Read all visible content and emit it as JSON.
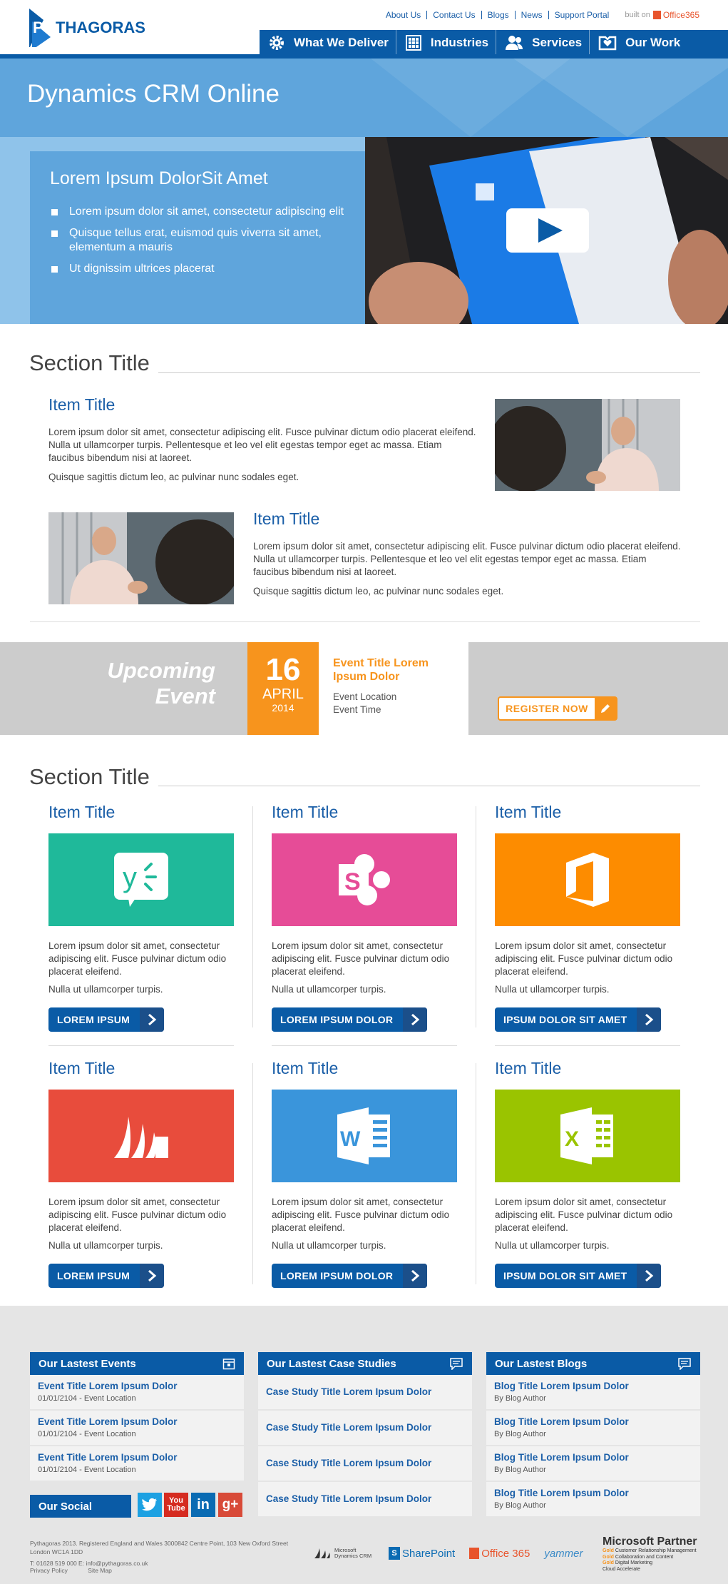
{
  "brand": {
    "logo_text": "PYTHAGORAS",
    "accent": "#0a5ba6"
  },
  "toplinks": [
    "About Us",
    "Contact Us",
    "Blogs",
    "News",
    "Support Portal"
  ],
  "built_on": {
    "label": "built on",
    "product": "Office365"
  },
  "nav": [
    {
      "label": "What We Deliver",
      "icon": "gear-icon"
    },
    {
      "label": "Industries",
      "icon": "grid-icon"
    },
    {
      "label": "Services",
      "icon": "people-icon"
    },
    {
      "label": "Our Work",
      "icon": "heart-box-icon"
    }
  ],
  "hero": {
    "title": "Dynamics CRM Online"
  },
  "feature": {
    "heading": "Lorem Ipsum DolorSit Amet",
    "bullets": [
      "Lorem ipsum dolor sit amet, consectetur adipiscing elit",
      "Quisque tellus erat, euismod quis viverra sit amet, elementum a mauris",
      "Ut dignissim ultrices placerat"
    ]
  },
  "section1": {
    "title": "Section Title",
    "items": [
      {
        "title": "Item Title",
        "text": "Lorem ipsum dolor sit amet, consectetur adipiscing elit. Fusce pulvinar dictum odio placerat eleifend. Nulla ut ullamcorper turpis. Pellentesque et leo vel elit egestas tempor eget ac massa. Etiam faucibus bibendum nisi at laoreet.",
        "text2": "Quisque sagittis dictum leo, ac pulvinar nunc sodales eget."
      },
      {
        "title": "Item Title",
        "text": "Lorem ipsum dolor sit amet, consectetur adipiscing elit. Fusce pulvinar dictum odio placerat eleifend. Nulla ut ullamcorper turpis. Pellentesque et leo vel elit egestas tempor eget ac massa. Etiam faucibus bibendum nisi at laoreet.",
        "text2": "Quisque sagittis dictum leo, ac pulvinar nunc sodales eget."
      }
    ]
  },
  "event": {
    "heading_line1": "Upcoming",
    "heading_line2": "Event",
    "day": "16",
    "month": "APRIL",
    "year": "2014",
    "title": "Event Title Lorem Ipsum Dolor",
    "location": "Event Location",
    "time": "Event Time",
    "register": "REGISTER NOW"
  },
  "section2": {
    "title": "Section Title",
    "cards": [
      {
        "title": "Item Title",
        "color": "#1fb99a",
        "icon": "yammer-icon",
        "text": "Lorem ipsum dolor sit amet, consectetur adipiscing elit. Fusce pulvinar dictum odio placerat eleifend.",
        "text2": "Nulla ut ullamcorper turpis.",
        "button": "LOREM IPSUM"
      },
      {
        "title": "Item Title",
        "color": "#e64c97",
        "icon": "sharepoint-icon",
        "text": "Lorem ipsum dolor sit amet, consectetur adipiscing elit. Fusce pulvinar dictum odio placerat eleifend.",
        "text2": "Nulla ut ullamcorper turpis.",
        "button": "LOREM IPSUM DOLOR"
      },
      {
        "title": "Item Title",
        "color": "#fd8c00",
        "icon": "office-icon",
        "text": "Lorem ipsum dolor sit amet, consectetur adipiscing elit. Fusce pulvinar dictum odio placerat eleifend.",
        "text2": "Nulla ut ullamcorper turpis.",
        "button": "IPSUM DOLOR SIT AMET"
      },
      {
        "title": "Item Title",
        "color": "#e84c3c",
        "icon": "dynamics-icon",
        "text": "Lorem ipsum dolor sit amet, consectetur adipiscing elit. Fusce pulvinar dictum odio placerat eleifend.",
        "text2": "Nulla ut ullamcorper turpis.",
        "button": "LOREM IPSUM"
      },
      {
        "title": "Item Title",
        "color": "#3a95db",
        "icon": "word-icon",
        "text": "Lorem ipsum dolor sit amet, consectetur adipiscing elit. Fusce pulvinar dictum odio placerat eleifend.",
        "text2": "Nulla ut ullamcorper turpis.",
        "button": "LOREM IPSUM DOLOR"
      },
      {
        "title": "Item Title",
        "color": "#9ac400",
        "icon": "excel-icon",
        "text": "Lorem ipsum dolor sit amet, consectetur adipiscing elit. Fusce pulvinar dictum odio placerat eleifend.",
        "text2": "Nulla ut ullamcorper turpis.",
        "button": "IPSUM DOLOR SIT AMET"
      }
    ]
  },
  "footer": {
    "events": {
      "heading": "Our Lastest Events",
      "items": [
        {
          "title": "Event Title Lorem Ipsum Dolor",
          "meta": "01/01/2104 - Event Location"
        },
        {
          "title": "Event Title Lorem Ipsum Dolor",
          "meta": "01/01/2104 - Event Location"
        },
        {
          "title": "Event Title Lorem Ipsum Dolor",
          "meta": "01/01/2104 - Event Location"
        }
      ]
    },
    "cases": {
      "heading": "Our Lastest Case Studies",
      "items": [
        "Case Study Title Lorem Ipsum Dolor",
        "Case Study Title Lorem Ipsum Dolor",
        "Case Study Title Lorem Ipsum Dolor",
        "Case Study Title Lorem Ipsum Dolor"
      ]
    },
    "blogs": {
      "heading": "Our Lastest Blogs",
      "items": [
        {
          "title": "Blog Title Lorem Ipsum Dolor",
          "meta": "By Blog Author"
        },
        {
          "title": "Blog Title Lorem Ipsum Dolor",
          "meta": "By Blog Author"
        },
        {
          "title": "Blog Title Lorem Ipsum Dolor",
          "meta": "By Blog Author"
        },
        {
          "title": "Blog Title Lorem Ipsum Dolor",
          "meta": "By Blog Author"
        }
      ]
    },
    "social": {
      "heading": "Our Social",
      "networks": [
        "twitter",
        "youtube",
        "linkedin",
        "google-plus"
      ]
    },
    "legal": "Pythagoras 2013. Registered England and Wales 3000842 Centre Point, 103 New Oxford Street London WC1A 1DD",
    "contact": "T: 01628 519 000 E: info@pythagoras.co.uk",
    "links": [
      "Privacy Policy",
      "Site Map"
    ],
    "partners": [
      "Microsoft Dynamics CRM",
      "SharePoint",
      "Office 365",
      "yammer"
    ],
    "ms_partner": {
      "title": "Microsoft Partner",
      "competencies": [
        {
          "level": "Gold",
          "name": "Customer Relationship Management"
        },
        {
          "level": "Gold",
          "name": "Collaboration and Content"
        },
        {
          "level": "Gold",
          "name": "Digital Marketing"
        },
        {
          "level": "",
          "name": "Cloud Accelerate"
        }
      ]
    }
  }
}
